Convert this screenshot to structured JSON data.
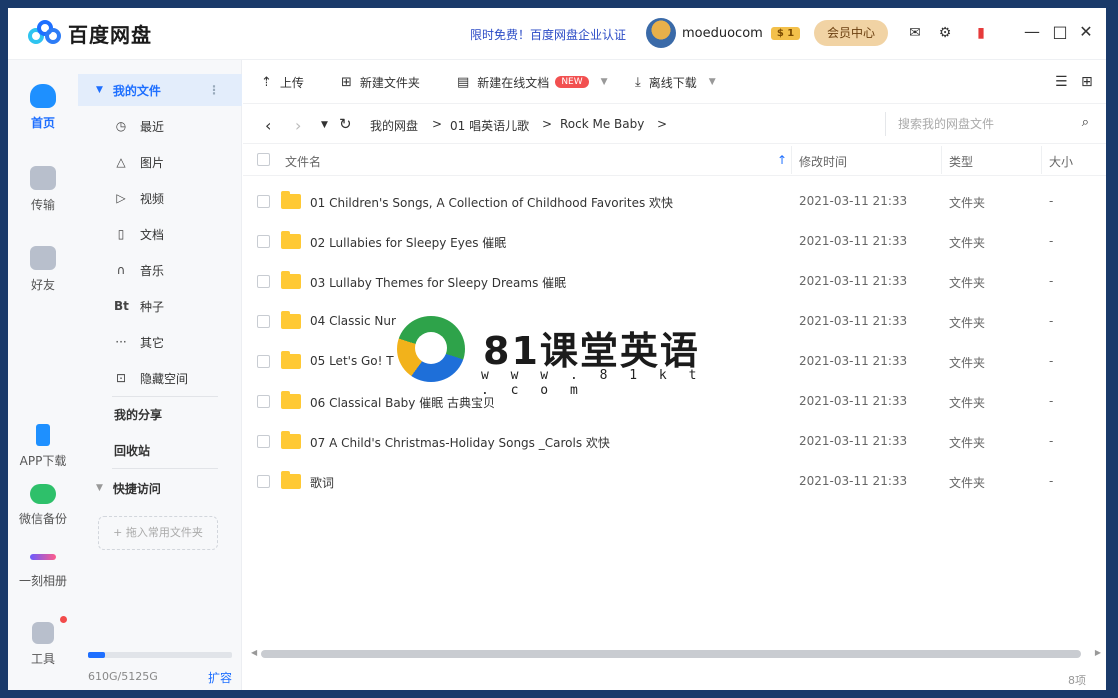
{
  "app": {
    "name": "百度网盘"
  },
  "titlebar": {
    "promo": "限时免费！百度网盘企业认证",
    "username": "moeduocom",
    "vip_level": "1",
    "vip_center": "会员中心"
  },
  "leftnav": {
    "home": "首页",
    "transfer": "传输",
    "friends": "好友",
    "app_download": "APP下载",
    "wechat_backup": "微信备份",
    "moment_album": "一刻相册",
    "tools": "工具"
  },
  "sidebar": {
    "my_files": "我的文件",
    "items": [
      {
        "label": "最近",
        "icon": "clock-icon"
      },
      {
        "label": "图片",
        "icon": "image-icon"
      },
      {
        "label": "视频",
        "icon": "play-icon"
      },
      {
        "label": "文档",
        "icon": "document-icon"
      },
      {
        "label": "音乐",
        "icon": "headphones-icon"
      },
      {
        "label": "种子",
        "icon": "bt-icon"
      },
      {
        "label": "其它",
        "icon": "more-icon"
      },
      {
        "label": "隐藏空间",
        "icon": "lock-icon"
      }
    ],
    "my_share": "我的分享",
    "recycle": "回收站",
    "quick_access": "快捷访问",
    "drop_hint": "+ 拖入常用文件夹",
    "quota": "610G/5125G",
    "quota_fraction": 0.119,
    "expand": "扩容"
  },
  "toolbar": {
    "upload": "上传",
    "new_folder": "新建文件夹",
    "new_online_doc": "新建在线文档",
    "new_badge": "NEW",
    "offline_download": "离线下载"
  },
  "breadcrumb": {
    "root": "我的网盘",
    "level1": "01 唱英语儿歌",
    "level2": "Rock Me Baby",
    "sep": ">"
  },
  "search": {
    "placeholder": "搜索我的网盘文件"
  },
  "table": {
    "headers": {
      "name": "文件名",
      "mtime": "修改时间",
      "type": "类型",
      "size": "大小"
    },
    "rows": [
      {
        "name": "01 Children's Songs, A Collection of Childhood Favorites 欢快",
        "mtime": "2021-03-11 21:33",
        "type": "文件夹",
        "size": "-"
      },
      {
        "name": "02 Lullabies for Sleepy Eyes  催眠",
        "mtime": "2021-03-11 21:33",
        "type": "文件夹",
        "size": "-"
      },
      {
        "name": "03 Lullaby Themes for Sleepy Dreams 催眠",
        "mtime": "2021-03-11 21:33",
        "type": "文件夹",
        "size": "-"
      },
      {
        "name": "04 Classic Nur",
        "mtime": "2021-03-11 21:33",
        "type": "文件夹",
        "size": "-"
      },
      {
        "name": "05 Let's Go! T",
        "mtime": "2021-03-11 21:33",
        "type": "文件夹",
        "size": "-"
      },
      {
        "name": "06 Classical Baby 催眠 古典宝贝",
        "mtime": "2021-03-11 21:33",
        "type": "文件夹",
        "size": "-"
      },
      {
        "name": "07 A Child's Christmas-Holiday Songs _Carols  欢快",
        "mtime": "2021-03-11 21:33",
        "type": "文件夹",
        "size": "-"
      },
      {
        "name": "歌词",
        "mtime": "2021-03-11 21:33",
        "type": "文件夹",
        "size": "-"
      }
    ]
  },
  "footer": {
    "count": "8项"
  },
  "watermark": {
    "title": "81课堂英语",
    "url": "w w w . 8 1 k t . c o m"
  }
}
